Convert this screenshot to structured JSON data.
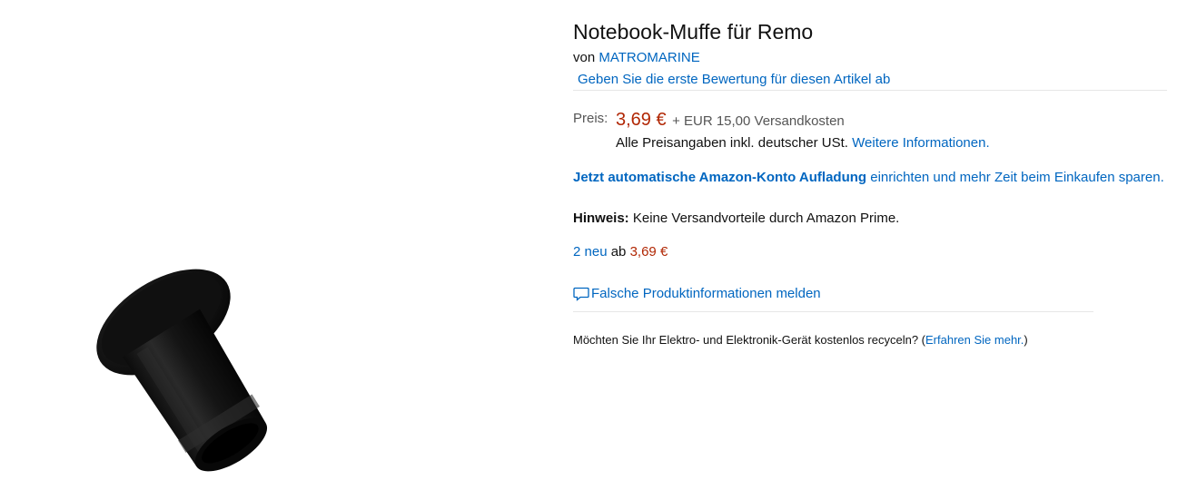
{
  "product": {
    "title": "Notebook-Muffe für Remo",
    "byline_prefix": "von ",
    "brand": "MATROMARINE",
    "review_link": "Geben Sie die erste Bewertung für diesen Artikel ab",
    "image_icon": "product-photo-black-sleeve"
  },
  "price": {
    "label": "Preis:",
    "value": "3,69 €",
    "shipping": "+ EUR 15,00 Versandkosten",
    "tax_text": "Alle Preisangaben inkl. deutscher USt.",
    "tax_link": "Weitere Informationen."
  },
  "topup": {
    "bold_text": "Jetzt automatische Amazon-Konto Aufladung",
    "rest_text": " einrichten und mehr Zeit beim Einkaufen sparen."
  },
  "hint": {
    "label": "Hinweis:",
    "text": " Keine Versandvorteile durch Amazon Prime."
  },
  "offers": {
    "link": "2 neu",
    "middle": " ab ",
    "price": "3,69 €"
  },
  "report": {
    "icon": "comment-icon",
    "label": "Falsche Produktinformationen melden"
  },
  "recycle": {
    "text": "Möchten Sie Ihr Elektro- und Elektronik-Gerät kostenlos recyceln? (",
    "link": "Erfahren Sie mehr.",
    "close": ")"
  },
  "colors": {
    "link": "#0066c0",
    "price": "#b12704",
    "divider": "#e7e7e7"
  }
}
